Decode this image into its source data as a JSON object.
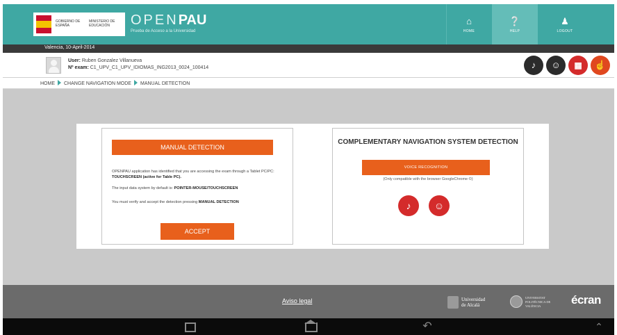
{
  "header": {
    "ministry_line1": "GOBIERNO DE ESPAÑA",
    "ministry_line2": "MINISTERIO DE EDUCACIÓN",
    "logo_open": "OPEN",
    "logo_pau": "PAU",
    "logo_subtitle": "Prueba de Acceso a la Universidad",
    "nav": [
      {
        "label": "HOME",
        "icon": "home-icon"
      },
      {
        "label": "HELP",
        "icon": "help-icon"
      },
      {
        "label": "LOGOUT",
        "icon": "user-icon"
      }
    ],
    "accent_color": "#3fa8a3"
  },
  "date_line": "Valencia, 10-April-2014",
  "user": {
    "user_label": "User:",
    "user_value": "Ruben Gonzalez Villanueva",
    "exam_label": "Nº exam:",
    "exam_value": "C1_UPV_C1_UPV_IDIOMAS_ING2013_0024_100414"
  },
  "toolbar": {
    "icons": [
      "audio-icon",
      "voice-icon",
      "keyboard-icon",
      "touch-icon"
    ]
  },
  "breadcrumb": {
    "items": [
      "HOME",
      "CHANGE NAVIGATION MODE",
      "MANUAL DETECTION"
    ]
  },
  "left_panel": {
    "manual_label": "MANUAL DETECTION",
    "p1_text": "OPENPAU application has identified that you are accessing the exam through a Tablet PC/PC: ",
    "p1_bold": "TOUCHSCREEN (active for Table PC).",
    "p2_text": "The input data system by default is: ",
    "p2_bold": "POINTER-MOUSE/TOUCHSCREEN",
    "p3_text": "You must verify and accept the detection pressing ",
    "p3_bold": "MANUAL DETECTION",
    "accept_label": "ACCEPT",
    "button_color": "#e8601c"
  },
  "right_panel": {
    "title": "COMPLEMENTARY NAVIGATION SYSTEM DETECTION",
    "voice_label": "VOICE RECOGNITION",
    "compat_note": "(Only compatible with the browser GoogleChrome ©)",
    "icons": [
      "audio-icon",
      "voice-icon"
    ]
  },
  "footer": {
    "aviso": "Aviso legal",
    "uah_line1": "Universidad",
    "uah_line2": "de Alcalá",
    "upv_text": "UNIVERSITAT POLITÈCNICA DE VALÈNCIA",
    "ecran": "écran"
  },
  "android_bar": {
    "buttons": [
      "recent-apps-icon",
      "home-icon",
      "back-icon",
      "chevron-up-icon"
    ]
  }
}
